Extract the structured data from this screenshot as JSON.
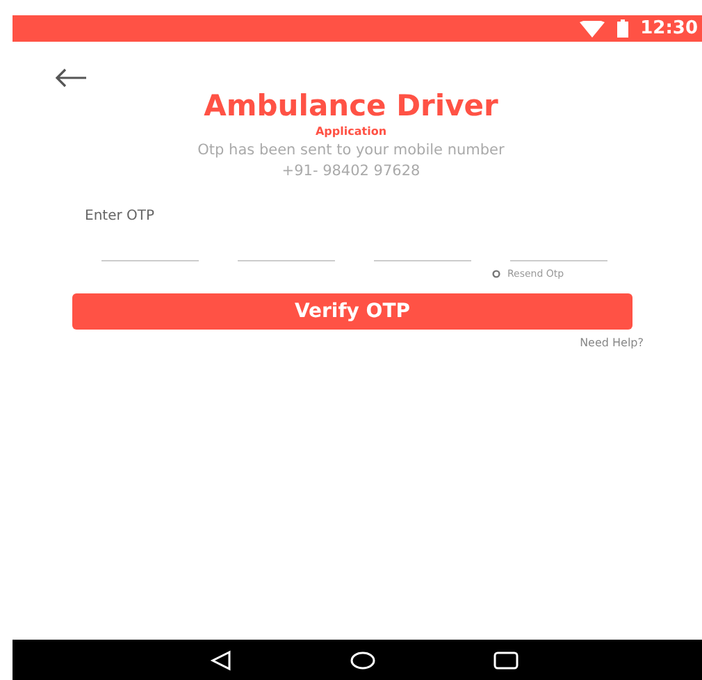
{
  "status_bar": {
    "time": "12:30"
  },
  "header": {
    "title": "Ambulance Driver",
    "subtitle": "Application"
  },
  "message": {
    "text": "Otp has been sent to your mobile number",
    "phone": "+91- 98402 97628"
  },
  "otp": {
    "label": "Enter  OTP",
    "resend": "Resend Otp"
  },
  "verify_button": "Verify OTP",
  "help_link": "Need Help?"
}
